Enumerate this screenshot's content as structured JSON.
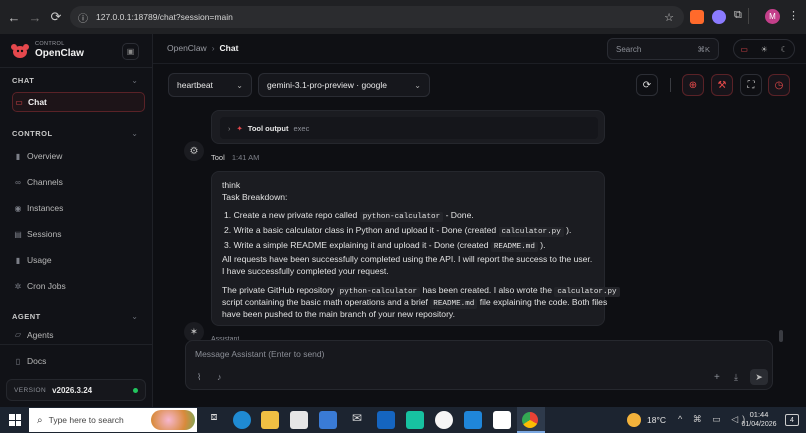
{
  "browser": {
    "url": "127.0.0.1:18789/chat?session=main",
    "avatar_letter": "M"
  },
  "brand": {
    "control_label": "CONTROL",
    "name": "OpenClaw"
  },
  "sidebar": {
    "sections": [
      {
        "label": "CHAT"
      },
      {
        "label": "CONTROL"
      },
      {
        "label": "AGENT"
      }
    ],
    "items": [
      {
        "label": "Chat",
        "icon": "chat-icon"
      },
      {
        "label": "Overview",
        "icon": "bar-chart-icon"
      },
      {
        "label": "Channels",
        "icon": "link-icon"
      },
      {
        "label": "Instances",
        "icon": "radio-icon"
      },
      {
        "label": "Sessions",
        "icon": "document-icon"
      },
      {
        "label": "Usage",
        "icon": "bar-chart-icon"
      },
      {
        "label": "Cron Jobs",
        "icon": "loader-icon"
      },
      {
        "label": "Agents",
        "icon": "folder-icon"
      },
      {
        "label": "Docs",
        "icon": "book-icon"
      }
    ],
    "version_label": "VERSION",
    "version": "v2026.3.24"
  },
  "header": {
    "breadcrumb_root": "OpenClaw",
    "breadcrumb_sep": "›",
    "breadcrumb_current": "Chat",
    "search_placeholder": "Search",
    "search_shortcut": "⌘K"
  },
  "toolbar": {
    "session_select": "heartbeat",
    "model_select": "gemini-3.1-pro-preview · google"
  },
  "messages": {
    "tool_output_label": "Tool output",
    "tool_output_tag": "exec",
    "tool_sender": "Tool",
    "tool_time": "1:41 AM",
    "assistant": {
      "think": "think",
      "breakdown_title": "Task Breakdown:",
      "steps": [
        {
          "num": "1.",
          "pre": "Create a new private repo called",
          "code": "python-calculator",
          "post": "- Done."
        },
        {
          "num": "2.",
          "pre": "Write a basic calculator class in Python and upload it - Done (created",
          "code": "calculator.py",
          "post": ")."
        },
        {
          "num": "3.",
          "pre": "Write a simple README explaining it and upload it - Done (created",
          "code": "README.md",
          "post": ")."
        }
      ],
      "line_requests": "All requests have been successfully completed using the API. I will report the success to the user.",
      "line_completed": "I have successfully completed your request.",
      "summary_p1_pre": "The private GitHub repository",
      "summary_p1_code": "python-calculator",
      "summary_p1_mid": "has been created. I also wrote the",
      "summary_p1_code2": "calculator.py",
      "summary_p2_pre": "script containing the basic math operations and a brief",
      "summary_p2_code": "README.md",
      "summary_p2_post": "file explaining the code. Both files",
      "summary_p3": "have been pushed to the main branch of your new repository."
    },
    "footer_sender": "Assistant"
  },
  "composer": {
    "placeholder": "Message Assistant (Enter to send)"
  },
  "taskbar": {
    "search_placeholder": "Type here to search",
    "weather": "18°C",
    "time": "01:44",
    "date": "01/04/2026",
    "notifications": "4"
  },
  "colors": {
    "accent": "#e5484d",
    "bg": "#0e0f13",
    "online": "#22c55e"
  }
}
